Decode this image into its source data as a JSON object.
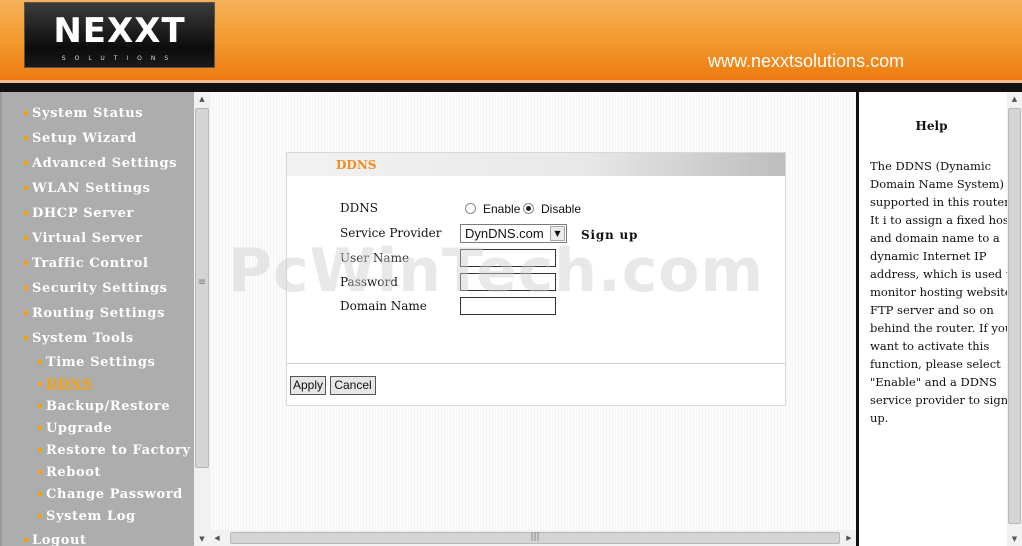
{
  "header": {
    "logo_text": "NEXXT",
    "logo_sub": "SOLUTIONS",
    "site_url": "www.nexxtsolutions.com"
  },
  "sidebar": {
    "items": [
      {
        "label": "System Status"
      },
      {
        "label": "Setup Wizard"
      },
      {
        "label": "Advanced Settings"
      },
      {
        "label": "WLAN Settings"
      },
      {
        "label": "DHCP Server"
      },
      {
        "label": "Virtual Server"
      },
      {
        "label": "Traffic Control"
      },
      {
        "label": "Security Settings"
      },
      {
        "label": "Routing Settings"
      },
      {
        "label": "System Tools"
      }
    ],
    "sub_items": [
      {
        "label": "Time Settings"
      },
      {
        "label": "DDNS"
      },
      {
        "label": "Backup/Restore"
      },
      {
        "label": "Upgrade"
      },
      {
        "label": "Restore to Factory"
      },
      {
        "label": "Reboot"
      },
      {
        "label": "Change Password"
      },
      {
        "label": "System Log"
      }
    ],
    "logout": "Logout",
    "active_item": "DDNS"
  },
  "panel": {
    "title": "DDNS",
    "ddns_label": "DDNS",
    "enable_label": "Enable",
    "disable_label": "Disable",
    "ddns_state": "Disable",
    "service_provider_label": "Service Provider",
    "service_provider_value": "DynDNS.com",
    "signup_label": "Sign up",
    "username_label": "User Name",
    "username_value": "",
    "password_label": "Password",
    "password_value": "",
    "domain_label": "Domain Name",
    "domain_value": "",
    "apply_label": "Apply",
    "cancel_label": "Cancel"
  },
  "watermark": "PcWinTech.com",
  "help": {
    "title": "Help",
    "body": "The DDNS (Dynamic Domain Name System) is supported in this router. It i to assign a fixed host and domain name to a dynamic Internet IP address, which is used to monitor hosting website, FTP server and so on behind the router. If you want to activate this function, please select \"Enable\" and a DDNS service provider to sign up."
  },
  "icons": {
    "scroll_up": "arrow-up-icon",
    "scroll_down": "arrow-down-icon",
    "scroll_left": "arrow-left-icon",
    "scroll_right": "arrow-right-icon",
    "dropdown": "chevron-down-icon"
  },
  "colors": {
    "header_orange": "#ee7d12",
    "sidebar_bg": "#adadad",
    "accent": "#f2a10f",
    "panel_title": "#f08c1c"
  }
}
